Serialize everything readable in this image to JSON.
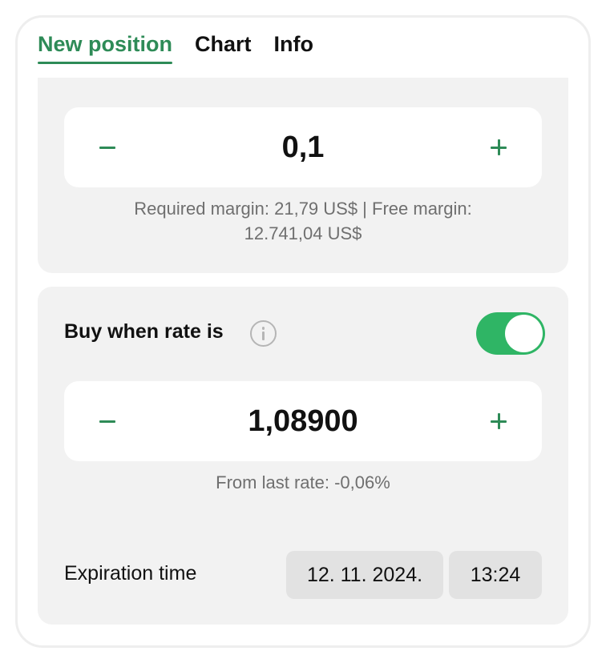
{
  "tabs": [
    {
      "label": "New position",
      "active": true
    },
    {
      "label": "Chart",
      "active": false
    },
    {
      "label": "Info",
      "active": false
    }
  ],
  "amount": {
    "value": "0,1",
    "required_margin_line1": "Required margin: 21,79 US$ | Free margin:",
    "required_margin_line2": "12.741,04 US$"
  },
  "limit_order": {
    "label": "Buy when rate is",
    "info_icon": "info-icon",
    "toggle_on": true,
    "rate_value": "1,08900",
    "from_last_rate": "From last rate: -0,06%"
  },
  "expiration": {
    "label": "Expiration time",
    "date": "12. 11. 2024.",
    "time": "13:24"
  },
  "colors": {
    "accent": "#2e8b57",
    "toggle_on": "#2fb565",
    "panel_bg": "#f2f2f2",
    "chip_bg": "#e2e2e2"
  }
}
